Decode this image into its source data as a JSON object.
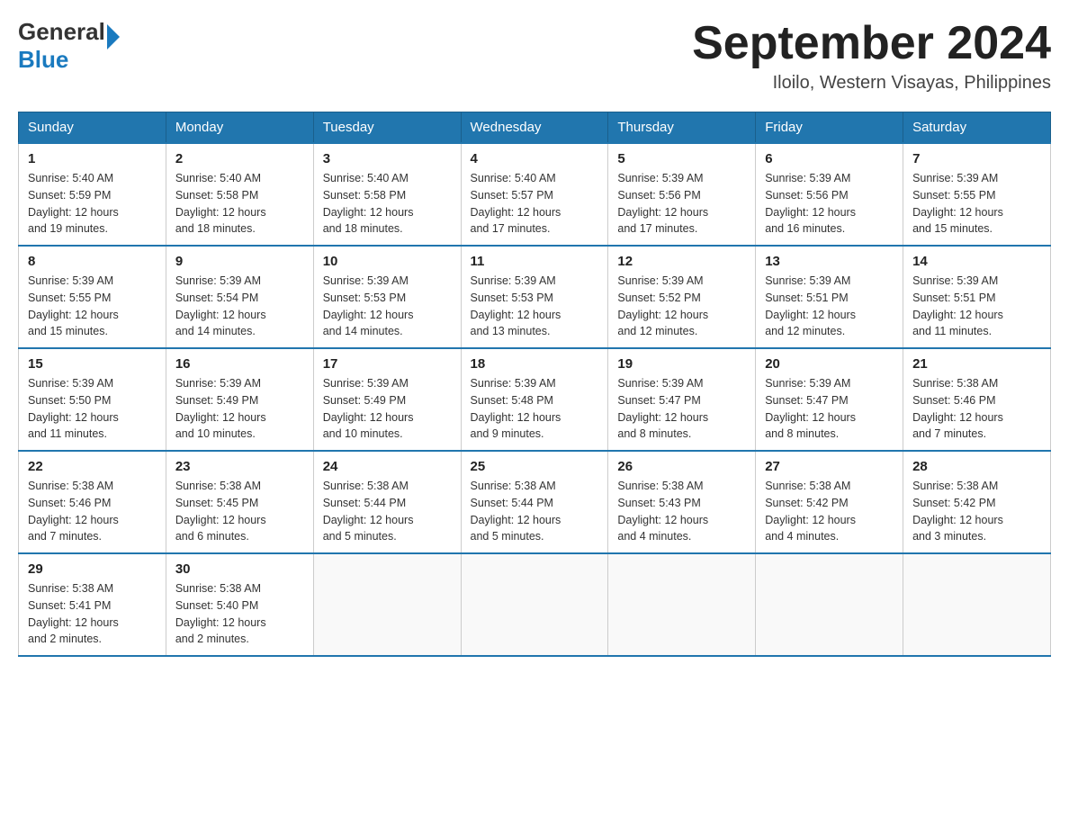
{
  "header": {
    "logo": {
      "general": "General",
      "blue": "Blue"
    },
    "title": "September 2024",
    "location": "Iloilo, Western Visayas, Philippines"
  },
  "days_of_week": [
    "Sunday",
    "Monday",
    "Tuesday",
    "Wednesday",
    "Thursday",
    "Friday",
    "Saturday"
  ],
  "weeks": [
    [
      {
        "day": 1,
        "sunrise": "5:40 AM",
        "sunset": "5:59 PM",
        "daylight": "12 hours and 19 minutes."
      },
      {
        "day": 2,
        "sunrise": "5:40 AM",
        "sunset": "5:58 PM",
        "daylight": "12 hours and 18 minutes."
      },
      {
        "day": 3,
        "sunrise": "5:40 AM",
        "sunset": "5:58 PM",
        "daylight": "12 hours and 18 minutes."
      },
      {
        "day": 4,
        "sunrise": "5:40 AM",
        "sunset": "5:57 PM",
        "daylight": "12 hours and 17 minutes."
      },
      {
        "day": 5,
        "sunrise": "5:39 AM",
        "sunset": "5:56 PM",
        "daylight": "12 hours and 17 minutes."
      },
      {
        "day": 6,
        "sunrise": "5:39 AM",
        "sunset": "5:56 PM",
        "daylight": "12 hours and 16 minutes."
      },
      {
        "day": 7,
        "sunrise": "5:39 AM",
        "sunset": "5:55 PM",
        "daylight": "12 hours and 15 minutes."
      }
    ],
    [
      {
        "day": 8,
        "sunrise": "5:39 AM",
        "sunset": "5:55 PM",
        "daylight": "12 hours and 15 minutes."
      },
      {
        "day": 9,
        "sunrise": "5:39 AM",
        "sunset": "5:54 PM",
        "daylight": "12 hours and 14 minutes."
      },
      {
        "day": 10,
        "sunrise": "5:39 AM",
        "sunset": "5:53 PM",
        "daylight": "12 hours and 14 minutes."
      },
      {
        "day": 11,
        "sunrise": "5:39 AM",
        "sunset": "5:53 PM",
        "daylight": "12 hours and 13 minutes."
      },
      {
        "day": 12,
        "sunrise": "5:39 AM",
        "sunset": "5:52 PM",
        "daylight": "12 hours and 12 minutes."
      },
      {
        "day": 13,
        "sunrise": "5:39 AM",
        "sunset": "5:51 PM",
        "daylight": "12 hours and 12 minutes."
      },
      {
        "day": 14,
        "sunrise": "5:39 AM",
        "sunset": "5:51 PM",
        "daylight": "12 hours and 11 minutes."
      }
    ],
    [
      {
        "day": 15,
        "sunrise": "5:39 AM",
        "sunset": "5:50 PM",
        "daylight": "12 hours and 11 minutes."
      },
      {
        "day": 16,
        "sunrise": "5:39 AM",
        "sunset": "5:49 PM",
        "daylight": "12 hours and 10 minutes."
      },
      {
        "day": 17,
        "sunrise": "5:39 AM",
        "sunset": "5:49 PM",
        "daylight": "12 hours and 10 minutes."
      },
      {
        "day": 18,
        "sunrise": "5:39 AM",
        "sunset": "5:48 PM",
        "daylight": "12 hours and 9 minutes."
      },
      {
        "day": 19,
        "sunrise": "5:39 AM",
        "sunset": "5:47 PM",
        "daylight": "12 hours and 8 minutes."
      },
      {
        "day": 20,
        "sunrise": "5:39 AM",
        "sunset": "5:47 PM",
        "daylight": "12 hours and 8 minutes."
      },
      {
        "day": 21,
        "sunrise": "5:38 AM",
        "sunset": "5:46 PM",
        "daylight": "12 hours and 7 minutes."
      }
    ],
    [
      {
        "day": 22,
        "sunrise": "5:38 AM",
        "sunset": "5:46 PM",
        "daylight": "12 hours and 7 minutes."
      },
      {
        "day": 23,
        "sunrise": "5:38 AM",
        "sunset": "5:45 PM",
        "daylight": "12 hours and 6 minutes."
      },
      {
        "day": 24,
        "sunrise": "5:38 AM",
        "sunset": "5:44 PM",
        "daylight": "12 hours and 5 minutes."
      },
      {
        "day": 25,
        "sunrise": "5:38 AM",
        "sunset": "5:44 PM",
        "daylight": "12 hours and 5 minutes."
      },
      {
        "day": 26,
        "sunrise": "5:38 AM",
        "sunset": "5:43 PM",
        "daylight": "12 hours and 4 minutes."
      },
      {
        "day": 27,
        "sunrise": "5:38 AM",
        "sunset": "5:42 PM",
        "daylight": "12 hours and 4 minutes."
      },
      {
        "day": 28,
        "sunrise": "5:38 AM",
        "sunset": "5:42 PM",
        "daylight": "12 hours and 3 minutes."
      }
    ],
    [
      {
        "day": 29,
        "sunrise": "5:38 AM",
        "sunset": "5:41 PM",
        "daylight": "12 hours and 2 minutes."
      },
      {
        "day": 30,
        "sunrise": "5:38 AM",
        "sunset": "5:40 PM",
        "daylight": "12 hours and 2 minutes."
      },
      null,
      null,
      null,
      null,
      null
    ]
  ]
}
